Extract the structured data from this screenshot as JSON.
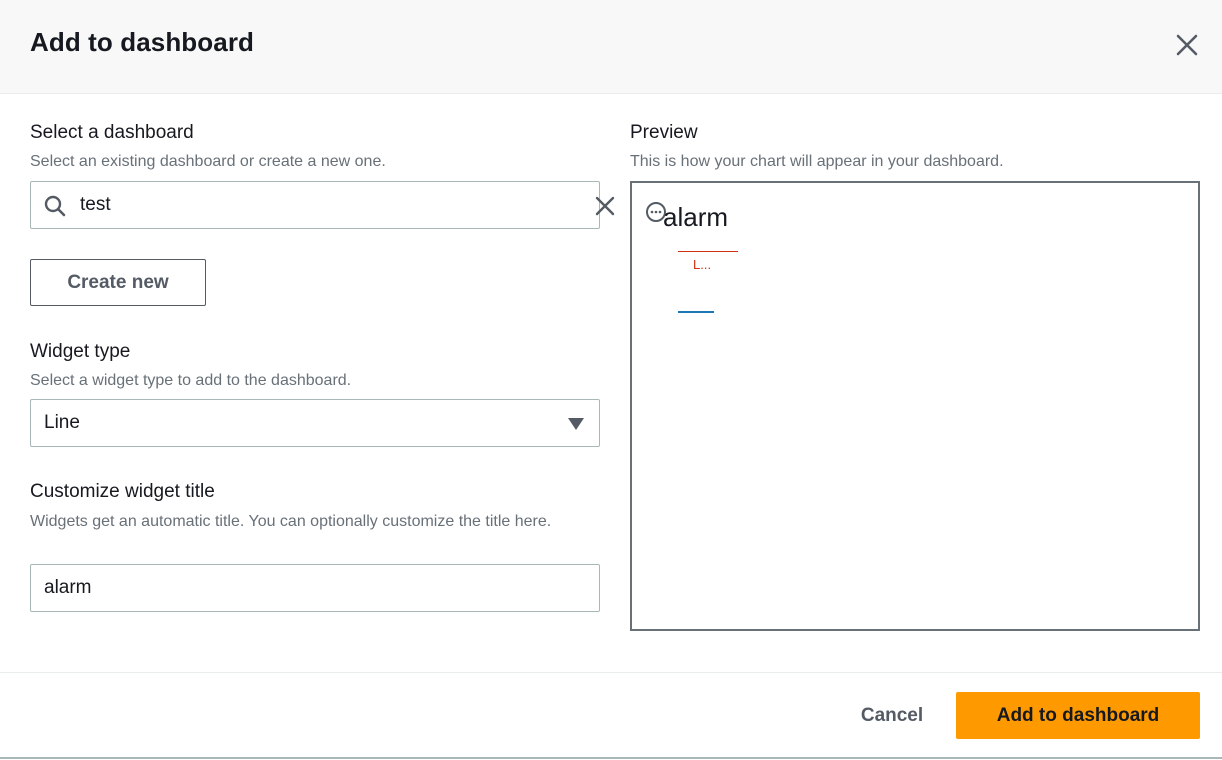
{
  "modal": {
    "title": "Add to dashboard"
  },
  "dashboard": {
    "label": "Select a dashboard",
    "description": "Select an existing dashboard or create a new one.",
    "search_value": "test",
    "create_button": "Create new"
  },
  "widget_type": {
    "label": "Widget type",
    "description": "Select a widget type to add to the dashboard.",
    "selected": "Line"
  },
  "widget_title": {
    "label": "Customize widget title",
    "description": "Widgets get an automatic title. You can optionally customize the title here.",
    "value": "alarm"
  },
  "preview": {
    "label": "Preview",
    "description": "This is how your chart will appear in your dashboard.",
    "chart_title": "alarm",
    "legend_item": "L..."
  },
  "footer": {
    "cancel_label": "Cancel",
    "add_label": "Add to dashboard"
  },
  "colors": {
    "primary_button": "#ff9900",
    "alarm_line": "#d13212",
    "metric_line": "#1f77b4"
  },
  "icons": {
    "close": "close-icon",
    "search": "search-icon",
    "clear": "clear-icon",
    "dropdown": "caret-down-icon",
    "preview_options": "ellipsis-circle-icon"
  }
}
